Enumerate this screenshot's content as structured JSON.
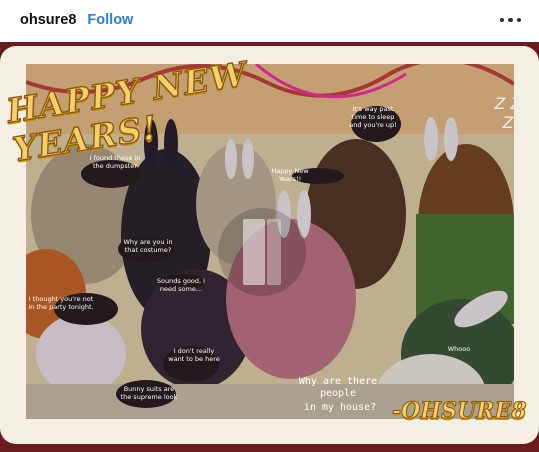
{
  "header": {
    "username": "ohsure8",
    "follow_label": "Follow",
    "more_icon": "more-horizontal-icon"
  },
  "artwork": {
    "title_text": "HAPPY NEW YEARS!",
    "signature": "-OHSURE8",
    "bubbles": [
      "I found these in the dumpster",
      "Why are you in that costume?",
      "I thought you're not in the party tonight.",
      "Sounds good, I need some...",
      "I don't really want to be here",
      "Bunny suits are the supreme look",
      "It's way past time to sleep and you're up!",
      "Happy New Years!!",
      "Whooo"
    ],
    "caption_line1": "Why are there people",
    "caption_line2": "in my house?",
    "zzz": "Z Z Z"
  },
  "media": {
    "play_icon": "play-icon",
    "dim_overlay": true
  },
  "colors": {
    "follow": "#2c7ce0",
    "frame_outer": "#6a1b1d",
    "frame_inner": "#f4efe4",
    "title_fill": "#f7d06a"
  }
}
